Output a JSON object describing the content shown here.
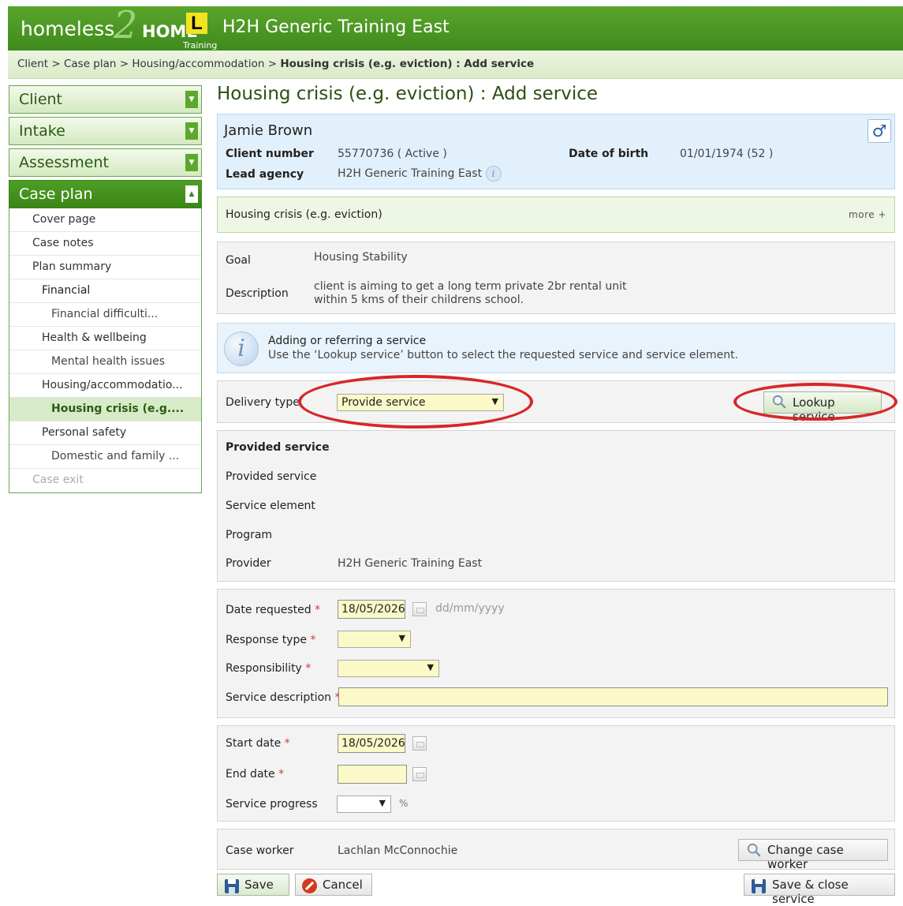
{
  "header": {
    "logo_homeless": "homeless",
    "logo_two": "2",
    "logo_home": "HOME",
    "logo_l": "L",
    "logo_training": "Training",
    "org_title": "H2H Generic Training East"
  },
  "breadcrumb": {
    "path": "Client > Case plan > Housing/accommodation > ",
    "current": "Housing crisis (e.g. eviction) : Add service"
  },
  "nav": {
    "sections": [
      {
        "label": "Client"
      },
      {
        "label": "Intake"
      },
      {
        "label": "Assessment"
      },
      {
        "label": "Case plan"
      }
    ],
    "items": [
      {
        "label": "Cover page"
      },
      {
        "label": "Case notes"
      },
      {
        "label": "Plan summary"
      },
      {
        "label": "Financial"
      },
      {
        "label": "Financial difficulti..."
      },
      {
        "label": "Health & wellbeing"
      },
      {
        "label": "Mental health issues"
      },
      {
        "label": "Housing/accommodatio..."
      },
      {
        "label": "Housing crisis (e.g...."
      },
      {
        "label": "Personal safety"
      },
      {
        "label": "Domestic and family ..."
      },
      {
        "label": "Case exit"
      }
    ]
  },
  "page_title": "Housing crisis (e.g. eviction) : Add service",
  "client": {
    "name": "Jamie Brown",
    "client_number_label": "Client number",
    "client_number": "55770736 ( Active )",
    "lead_agency_label": "Lead agency",
    "lead_agency": "H2H Generic Training East",
    "dob_label": "Date of birth",
    "dob": "01/01/1974 (52 )",
    "gender_symbol": "♂"
  },
  "plan": {
    "heading": "Housing crisis (e.g. eviction)",
    "more": "more +",
    "goal_label": "Goal",
    "goal": "Housing Stability",
    "description_label": "Description",
    "description_line1": "client is aiming to get a long term private 2br rental unit",
    "description_line2": "within 5 kms of their childrens school."
  },
  "info": {
    "title": "Adding or referring a service",
    "text": "Use the ‘Lookup service’ button to select the requested service and service element."
  },
  "delivery": {
    "label": "Delivery type",
    "value": "Provide service",
    "lookup_button": "Lookup service"
  },
  "service": {
    "heading": "Provided service",
    "provided_label": "Provided service",
    "element_label": "Service element",
    "program_label": "Program",
    "provider_label": "Provider",
    "provider": "H2H Generic Training East"
  },
  "request": {
    "date_label": "Date requested",
    "date_value": "18/05/2026",
    "date_hint": "dd/mm/yyyy",
    "response_label": "Response type",
    "responsibility_label": "Responsibility",
    "description_label": "Service description",
    "required_marker": "*"
  },
  "schedule": {
    "start_label": "Start date",
    "start_value": "18/05/2026",
    "end_label": "End date",
    "progress_label": "Service progress",
    "percent": "%"
  },
  "worker": {
    "label": "Case worker",
    "name": "Lachlan McConnochie",
    "change_button": "Change case worker"
  },
  "actions": {
    "save": "Save",
    "cancel": "Cancel",
    "save_close": "Save & close service"
  },
  "colors": {
    "header_green": "#4d9e25",
    "field_yellow": "#fbf9c7",
    "highlight_red": "#d62828"
  }
}
